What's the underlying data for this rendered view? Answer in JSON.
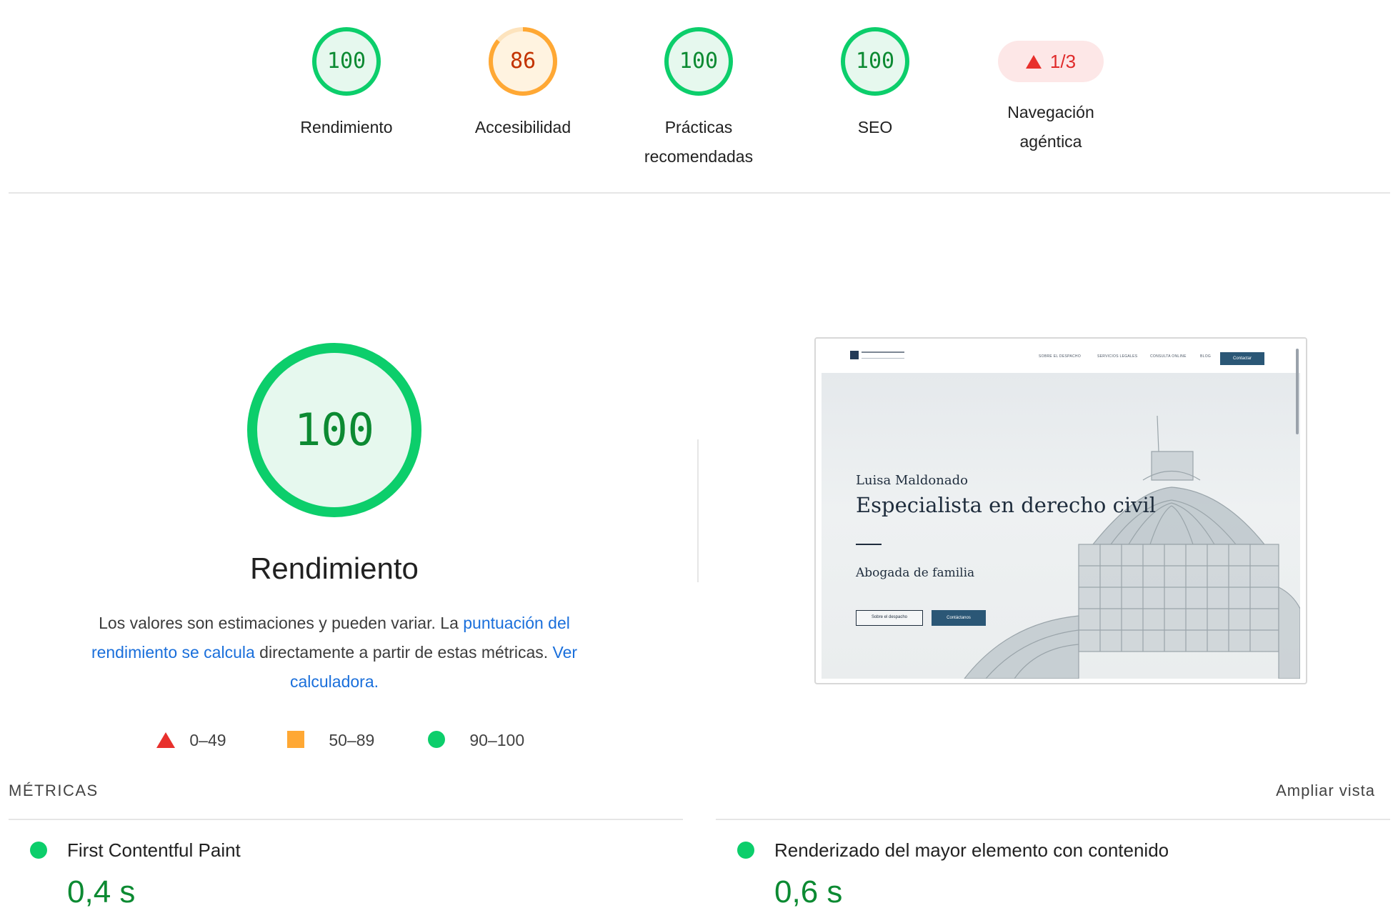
{
  "scores": [
    {
      "value": "100",
      "label": "Rendimiento",
      "status": "pass"
    },
    {
      "value": "86",
      "label": "Accesibilidad",
      "status": "average"
    },
    {
      "value": "100",
      "label": "Prácticas recomendadas",
      "status": "pass"
    },
    {
      "value": "100",
      "label": "SEO",
      "status": "pass"
    }
  ],
  "agentic": {
    "value": "1/3",
    "label": "Navegación agéntica"
  },
  "performance": {
    "score": "100",
    "title": "Rendimiento",
    "desc_1": "Los valores son estimaciones y pueden variar. La ",
    "link_1": "puntuación del rendimiento se calcula",
    "desc_2": " directamente a partir de estas métricas. ",
    "link_2": "Ver calculadora."
  },
  "legend": {
    "fail": "0–49",
    "average": "50–89",
    "pass": "90–100"
  },
  "screenshot": {
    "menu_items": [
      "SOBRE EL DESPACHO",
      "SERVICIOS LEGALES",
      "CONSULTA ONLINE",
      "BLOG"
    ],
    "cta": "Contactar",
    "name": "Luisa Maldonado",
    "title": "Especialista en derecho civil",
    "subtitle": "Abogada de familia",
    "btn_primary": "Sobre el despacho",
    "btn_secondary": "Contáctanos"
  },
  "metrics_section": {
    "heading": "MÉTRICAS",
    "expand": "Ampliar vista"
  },
  "metrics": [
    {
      "name": "First Contentful Paint",
      "value": "0,4 s"
    },
    {
      "name": "Renderizado del mayor elemento con contenido",
      "value": "0,6 s"
    }
  ],
  "colors": {
    "pass": "#0cce6b",
    "pass_text": "#0c8a32",
    "pass_bg": "#e6f8ee",
    "average": "#ffa834",
    "average_text": "#c33300",
    "average_bg": "#fff3e0",
    "fail": "#e8302c",
    "link": "#1a6fdb"
  }
}
